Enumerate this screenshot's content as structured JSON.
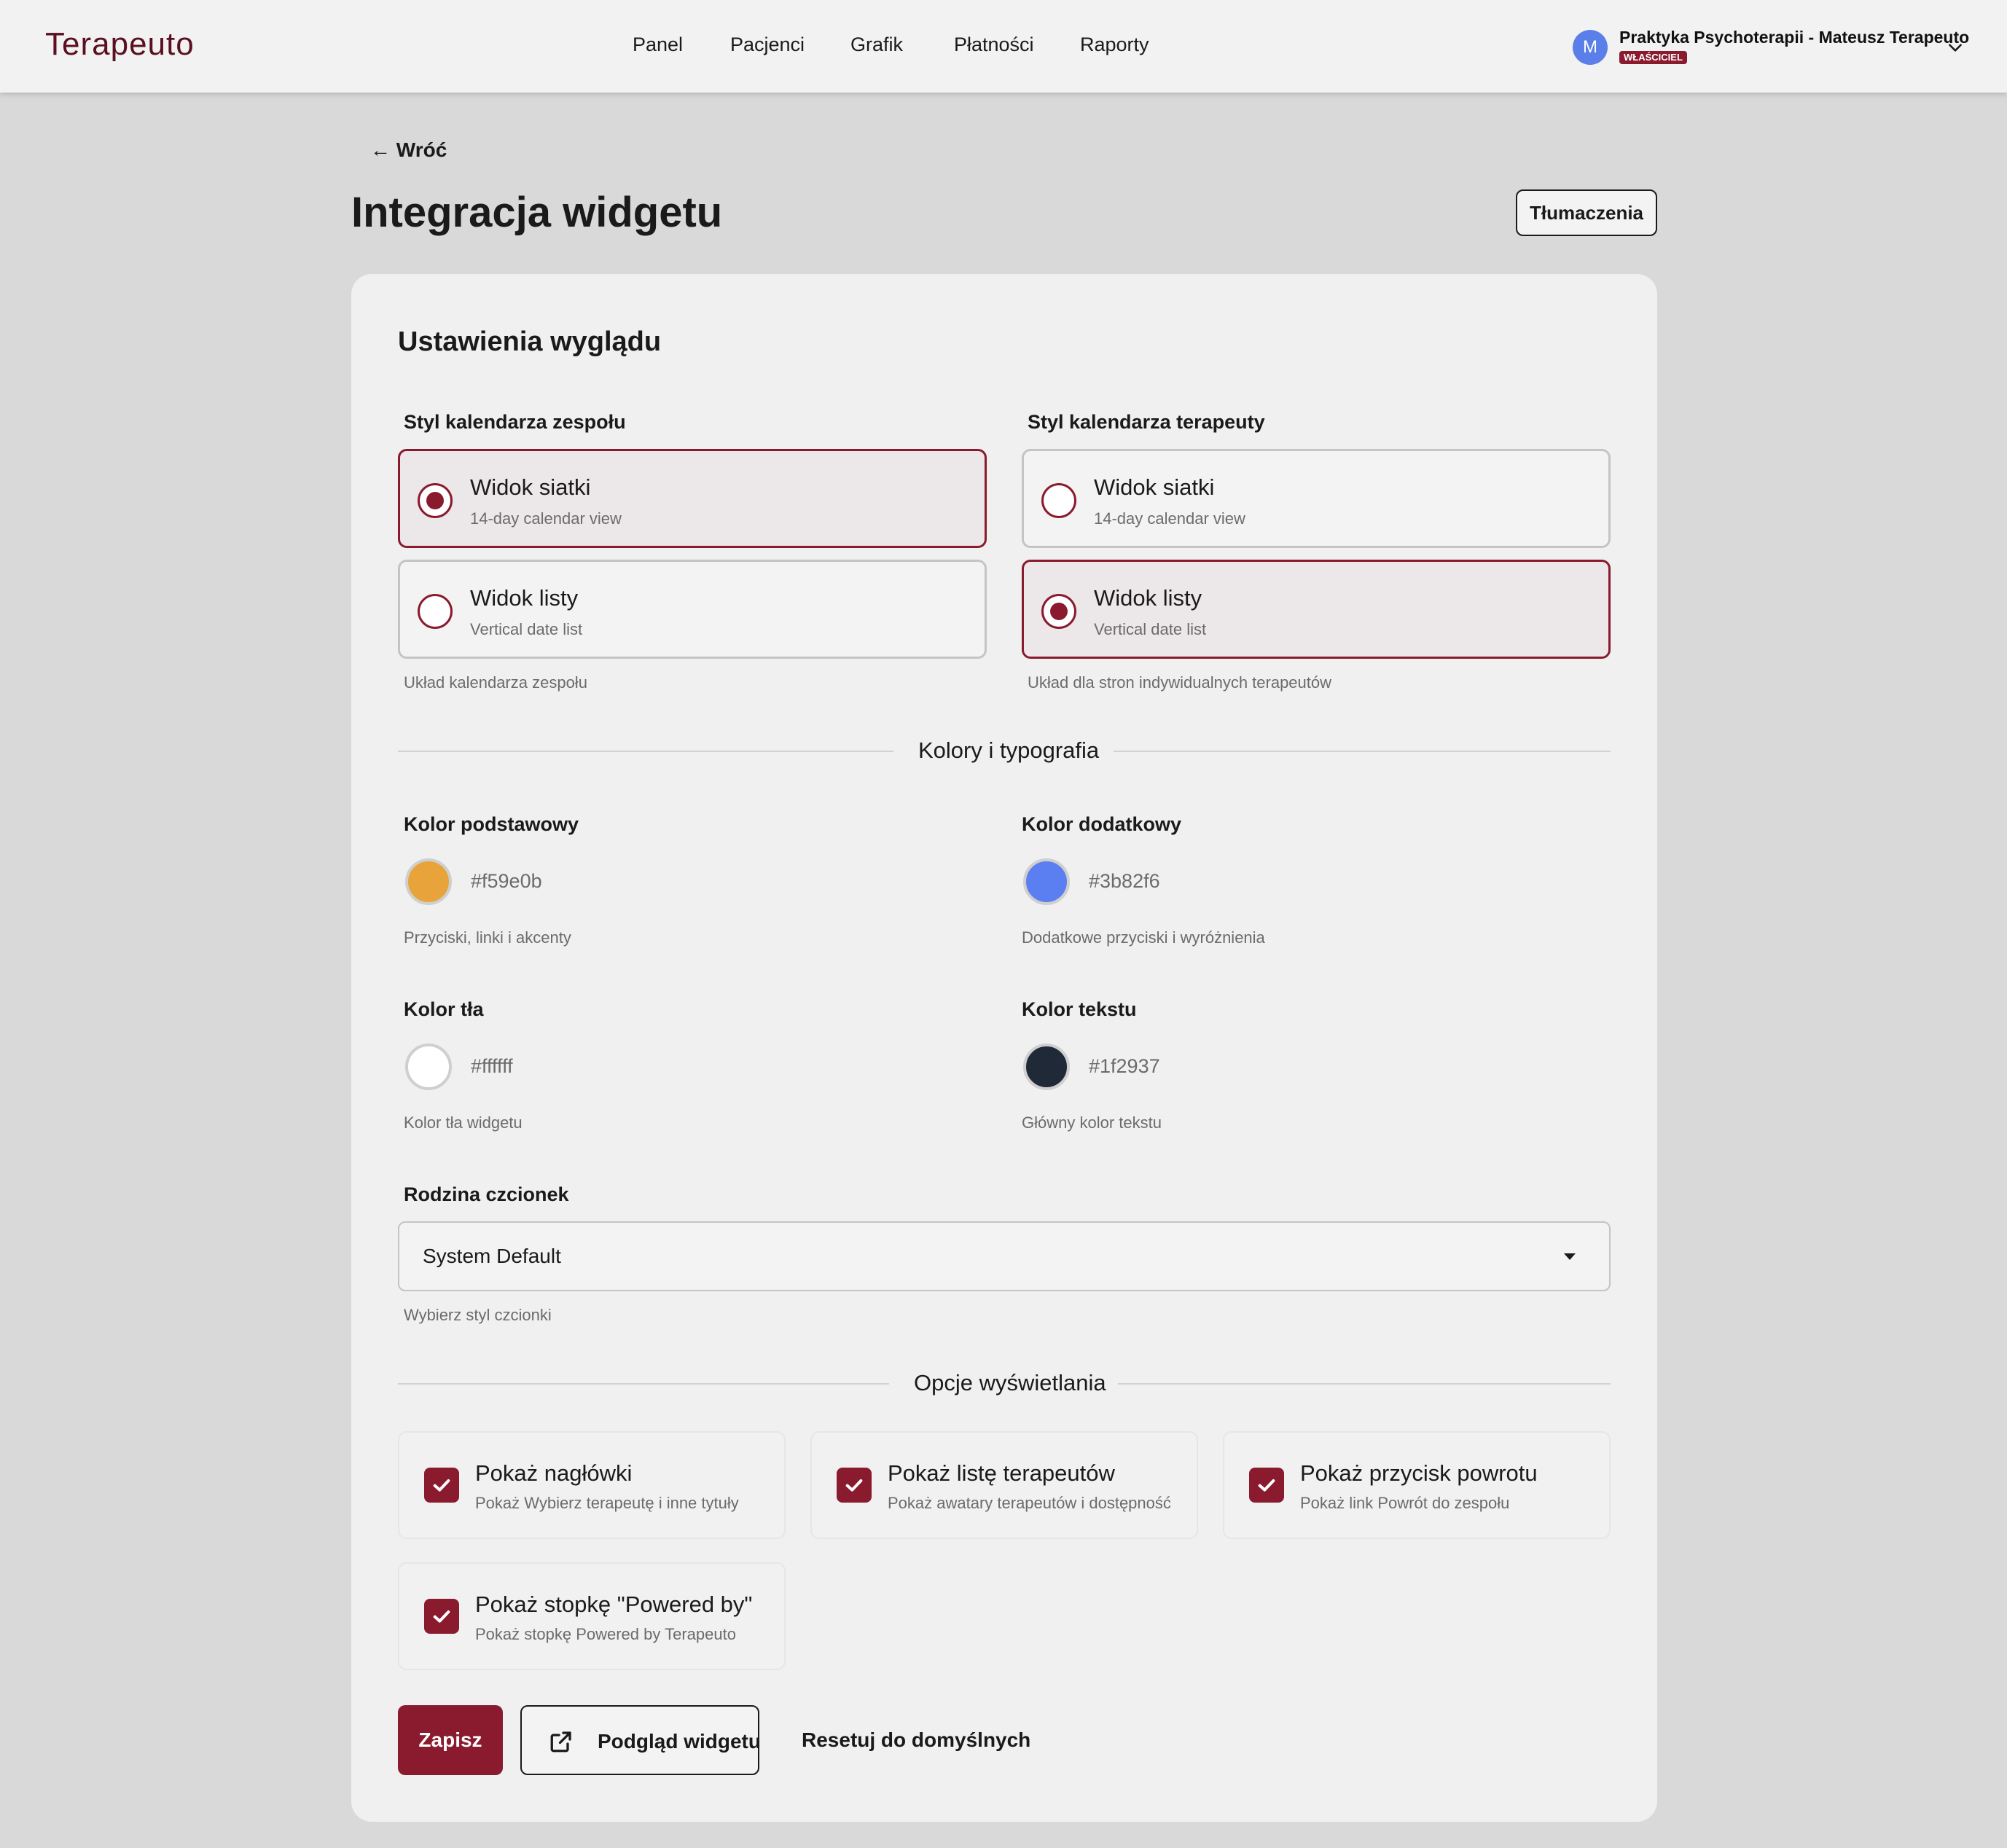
{
  "app": {
    "brand": "Terapeuto"
  },
  "nav": {
    "items": [
      "Panel",
      "Pacjenci",
      "Grafik",
      "Płatności",
      "Raporty"
    ]
  },
  "account": {
    "avatar_initial": "M",
    "name": "Praktyka Psychoterapii - Mateusz Terapeuto",
    "role": "WŁAŚCICIEL"
  },
  "header": {
    "back_label": "← Wróć",
    "title": "Integracja widgetu",
    "translations_button": "Tłumaczenia"
  },
  "appearance": {
    "title": "Ustawienia wyglądu",
    "team_calendar": {
      "label": "Styl kalendarza zespołu",
      "options": [
        {
          "title": "Widok siatki",
          "subtitle": "14-day calendar view",
          "selected": true
        },
        {
          "title": "Widok listy",
          "subtitle": "Vertical date list",
          "selected": false
        }
      ],
      "helper": "Układ kalendarza zespołu"
    },
    "therapist_calendar": {
      "label": "Styl kalendarza terapeuty",
      "options": [
        {
          "title": "Widok siatki",
          "subtitle": "14-day calendar view",
          "selected": false
        },
        {
          "title": "Widok listy",
          "subtitle": "Vertical date list",
          "selected": true
        }
      ],
      "helper": "Układ dla stron indywidualnych terapeutów"
    }
  },
  "colors": {
    "section_title": "Kolory i typografia",
    "primary": {
      "label": "Kolor podstawowy",
      "value": "#f59e0b",
      "swatch": "#e8a33a",
      "helper": "Przyciski, linki i akcenty"
    },
    "secondary": {
      "label": "Kolor dodatkowy",
      "value": "#3b82f6",
      "swatch": "#5b7ff0",
      "helper": "Dodatkowe przyciski i wyróżnienia"
    },
    "background": {
      "label": "Kolor tła",
      "value": "#ffffff",
      "swatch": "#ffffff",
      "helper": "Kolor tła widgetu"
    },
    "text": {
      "label": "Kolor tekstu",
      "value": "#1f2937",
      "swatch": "#1f2937",
      "helper": "Główny kolor tekstu"
    }
  },
  "font": {
    "label": "Rodzina czcionek",
    "value": "System Default",
    "helper": "Wybierz styl czcionki"
  },
  "display": {
    "section_title": "Opcje wyświetlania",
    "options": [
      {
        "title": "Pokaż nagłówki",
        "subtitle": "Pokaż Wybierz terapeutę i inne tytuły",
        "checked": true
      },
      {
        "title": "Pokaż listę terapeutów",
        "subtitle": "Pokaż awatary terapeutów i dostępność",
        "checked": true
      },
      {
        "title": "Pokaż przycisk powrotu",
        "subtitle": "Pokaż link Powrót do zespołu",
        "checked": true
      },
      {
        "title": "Pokaż stopkę \"Powered by\"",
        "subtitle": "Pokaż stopkę Powered by Terapeuto",
        "checked": true
      }
    ]
  },
  "actions": {
    "save": "Zapisz",
    "preview": "Podgląd widgetu",
    "reset": "Resetuj do domyślnych"
  },
  "theme": {
    "accent": "#8a1a2e",
    "page_bg": "#d9d9d9",
    "card_bg": "#f0f0f0"
  }
}
